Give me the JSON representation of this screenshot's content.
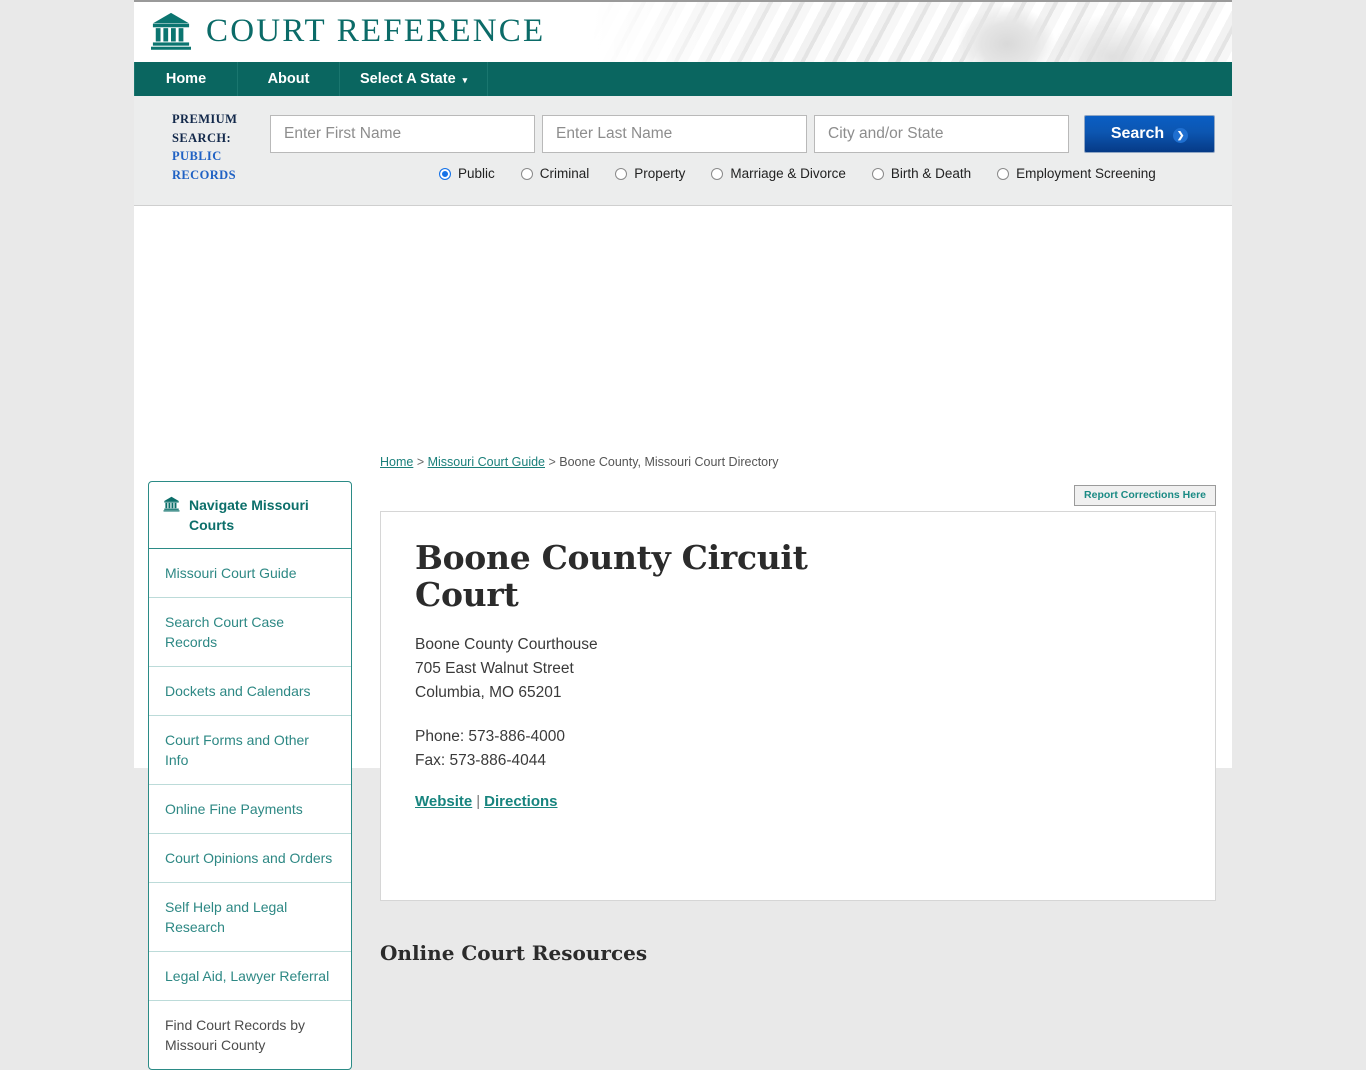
{
  "site": {
    "brand_name": "COURT REFERENCE",
    "brand_icon": "courthouse-icon"
  },
  "nav": {
    "items": [
      {
        "label": "Home"
      },
      {
        "label": "About"
      },
      {
        "label": "Select A State",
        "caret": "▾"
      }
    ]
  },
  "premium_search": {
    "label_line1": "PREMIUM",
    "label_line2": "SEARCH:",
    "link_line1": "PUBLIC",
    "link_line2": "RECORDS",
    "first_name_placeholder": "Enter First Name",
    "first_name_value": "",
    "last_name_placeholder": "Enter Last Name",
    "last_name_value": "",
    "city_state_placeholder": "City and/or State",
    "city_state_value": "",
    "search_button": "Search",
    "search_chevron": "❯",
    "radios": [
      {
        "label": "Public",
        "selected": true
      },
      {
        "label": "Criminal",
        "selected": false
      },
      {
        "label": "Property",
        "selected": false
      },
      {
        "label": "Marriage & Divorce",
        "selected": false
      },
      {
        "label": "Birth & Death",
        "selected": false
      },
      {
        "label": "Employment Screening",
        "selected": false
      }
    ]
  },
  "breadcrumb": {
    "home": "Home",
    "sep1": " > ",
    "guide": "Missouri Court Guide",
    "sep2": " > ",
    "current": "Boone County, Missouri Court Directory"
  },
  "report_corrections": {
    "label": "Report Corrections Here"
  },
  "sidebar": {
    "heading": "Navigate Missouri Courts",
    "heading_icon": "courthouse-icon",
    "items": [
      {
        "label": "Missouri Court Guide",
        "current": false
      },
      {
        "label": "Search Court Case Records",
        "current": false
      },
      {
        "label": "Dockets and Calendars",
        "current": false
      },
      {
        "label": "Court Forms and Other Info",
        "current": false
      },
      {
        "label": "Online Fine Payments",
        "current": false
      },
      {
        "label": "Court Opinions and Orders",
        "current": false
      },
      {
        "label": "Self Help and Legal Research",
        "current": false
      },
      {
        "label": "Legal Aid, Lawyer Referral",
        "current": false
      },
      {
        "label": "Find Court Records by Missouri County",
        "current": true
      }
    ]
  },
  "main": {
    "title": "Boone County Circuit Court",
    "address_line1": "Boone County Courthouse",
    "address_line2": "705 East Walnut Street",
    "address_line3": "Columbia, MO 65201",
    "phone": "Phone: 573-886-4000",
    "fax": "Fax: 573-886-4044",
    "website_link": "Website",
    "link_separator": "|",
    "directions_link": "Directions",
    "resources_heading": "Online Court Resources"
  },
  "colors": {
    "brand_teal": "#0b6b68",
    "nav_teal": "#0a6660",
    "link_teal": "#17847e",
    "search_blue": "#0c56b1",
    "premium_navy": "#13294b",
    "premium_link_blue": "#1f61c4"
  }
}
